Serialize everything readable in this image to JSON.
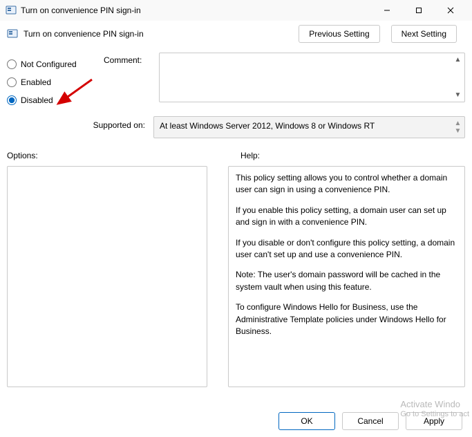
{
  "window": {
    "title": "Turn on convenience PIN sign-in"
  },
  "header": {
    "policy_title": "Turn on convenience PIN sign-in",
    "prev_label": "Previous Setting",
    "next_label": "Next Setting"
  },
  "state": {
    "not_configured_label": "Not Configured",
    "enabled_label": "Enabled",
    "disabled_label": "Disabled",
    "selected": "disabled"
  },
  "comment": {
    "label": "Comment:",
    "value": ""
  },
  "supported": {
    "label": "Supported on:",
    "value": "At least Windows Server 2012, Windows 8 or Windows RT"
  },
  "sections": {
    "options_label": "Options:",
    "help_label": "Help:"
  },
  "help": {
    "p1": "This policy setting allows you to control whether a domain user can sign in using a convenience PIN.",
    "p2": "If you enable this policy setting, a domain user can set up and sign in with a convenience PIN.",
    "p3": "If you disable or don't configure this policy setting, a domain user can't set up and use a convenience PIN.",
    "p4": "Note: The user's domain password will be cached in the system vault when using this feature.",
    "p5": "To configure Windows Hello for Business, use the Administrative Template policies under Windows Hello for Business."
  },
  "footer": {
    "ok_label": "OK",
    "cancel_label": "Cancel",
    "apply_label": "Apply"
  },
  "watermark": {
    "line1": "Activate Windo",
    "line2": "Go to Settings to act"
  }
}
